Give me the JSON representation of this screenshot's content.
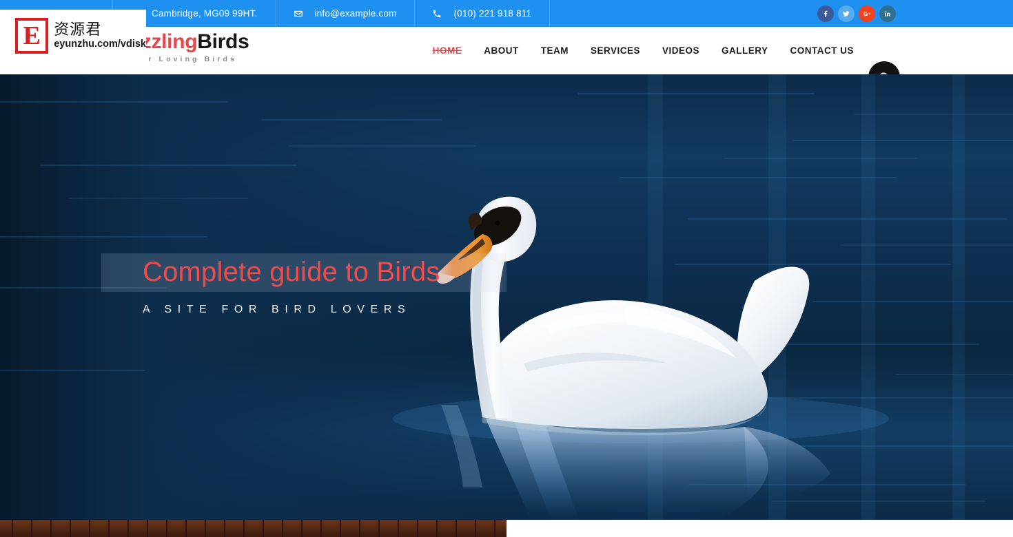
{
  "topbar": {
    "background_color": "#1e90f0",
    "contacts": [
      {
        "icon": "map-marker-icon",
        "text": "Cambridge, MG09 99HT."
      },
      {
        "icon": "envelope-icon",
        "text": "info@example.com"
      },
      {
        "icon": "phone-icon",
        "text": "(010) 221 918 811"
      }
    ],
    "socials": [
      {
        "name": "facebook-icon",
        "label": "f",
        "color": "#3b5998"
      },
      {
        "name": "twitter-icon",
        "label": "t",
        "color": "#55acee"
      },
      {
        "name": "google-plus-icon",
        "label": "G+",
        "color": "#f4411e"
      },
      {
        "name": "linkedin-icon",
        "label": "in",
        "color": "#2f6f8f"
      }
    ]
  },
  "header": {
    "brand_part1": "Dazzling",
    "brand_part2": "Birds",
    "brand_tagline": "Your Loving Birds",
    "brand_accent_color": "#e8444c",
    "nav": [
      {
        "label": "HOME",
        "active": true
      },
      {
        "label": "ABOUT",
        "active": false
      },
      {
        "label": "TEAM",
        "active": false
      },
      {
        "label": "SERVICES",
        "active": false
      },
      {
        "label": "VIDEOS",
        "active": false
      },
      {
        "label": "GALLERY",
        "active": false
      },
      {
        "label": "CONTACT US",
        "active": false
      }
    ],
    "search_icon": "search-icon"
  },
  "hero": {
    "title": "Complete guide to Birds",
    "subtitle": "A SITE FOR BIRD LOVERS",
    "title_color": "#ef4b4b",
    "subtitle_color": "#f2f5f8",
    "image_subject": "white mute swan swimming on dark blue water with reflection"
  },
  "footer_strip": {
    "left_texture": "wooden-slats",
    "left_color": "#4d2415",
    "right_color": "#ffffff"
  },
  "watermark": {
    "logo_letter": "E",
    "chinese_text": "资源君",
    "url_text": "eyunzhu.com/vdisk",
    "accent_color": "#d81e20"
  }
}
